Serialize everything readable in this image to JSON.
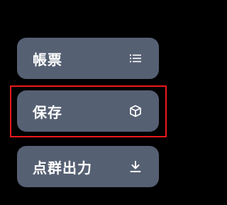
{
  "colors": {
    "background": "#000000",
    "button": "#566073",
    "text": "#ffffff",
    "highlight": "#e8191c"
  },
  "menu": {
    "items": [
      {
        "label": "帳票",
        "icon": "list-icon"
      },
      {
        "label": "保存",
        "icon": "cube-icon"
      },
      {
        "label": "点群出力",
        "icon": "download-icon"
      }
    ],
    "highlighted_item": "保存"
  }
}
